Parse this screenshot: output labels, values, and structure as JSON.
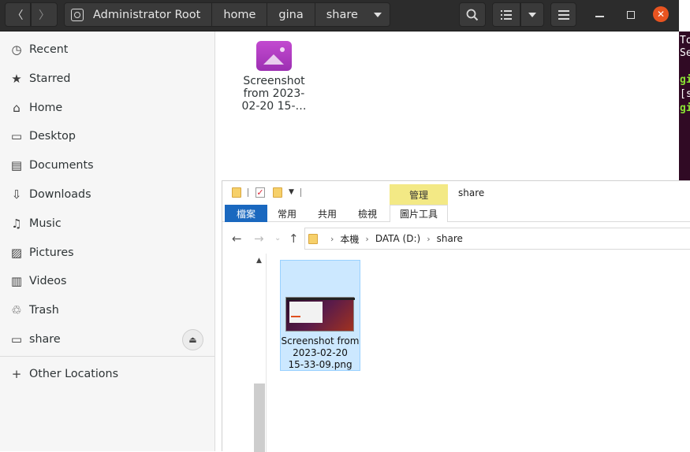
{
  "nautilus": {
    "breadcrumbs": [
      "Administrator Root",
      "home",
      "gina",
      "share"
    ],
    "sidebar": {
      "items": [
        {
          "label": "Recent",
          "icon": "clock-icon",
          "glyph": "◷"
        },
        {
          "label": "Starred",
          "icon": "star-icon",
          "glyph": "★"
        },
        {
          "label": "Home",
          "icon": "home-icon",
          "glyph": "⌂"
        },
        {
          "label": "Desktop",
          "icon": "desktop-icon",
          "glyph": "▭"
        },
        {
          "label": "Documents",
          "icon": "document-icon",
          "glyph": "▤"
        },
        {
          "label": "Downloads",
          "icon": "download-icon",
          "glyph": "⇩"
        },
        {
          "label": "Music",
          "icon": "music-icon",
          "glyph": "♫"
        },
        {
          "label": "Pictures",
          "icon": "pictures-icon",
          "glyph": "▨"
        },
        {
          "label": "Videos",
          "icon": "video-icon",
          "glyph": "▥"
        },
        {
          "label": "Trash",
          "icon": "trash-icon",
          "glyph": "♲"
        },
        {
          "label": "share",
          "icon": "drive-icon",
          "glyph": "▭"
        }
      ],
      "other_locations": "Other Locations"
    },
    "file": {
      "label_lines": [
        "Screenshot",
        "from 2023-",
        "02-20 15-…"
      ]
    },
    "accent_close": "#e95420"
  },
  "terminal": {
    "lines": [
      {
        "text": "To",
        "style": "normal"
      },
      {
        "text": "Se",
        "style": "normal"
      },
      {
        "text": "",
        "style": "normal"
      },
      {
        "text": "gi",
        "style": "green"
      },
      {
        "text": "[s",
        "style": "normal"
      },
      {
        "text": "gi",
        "style": "green"
      }
    ]
  },
  "explorer": {
    "manage_tab": "管理",
    "title": "share",
    "tabs": {
      "file": "檔案",
      "home": "常用",
      "share": "共用",
      "view": "檢視",
      "picture_tools": "圖片工具"
    },
    "address": [
      "本機",
      "DATA (D:)",
      "share"
    ],
    "selected_file_lines": [
      "Screenshot from",
      "2023-02-20",
      "15-33-09.png"
    ],
    "file_tab_color": "#1a68bf"
  }
}
